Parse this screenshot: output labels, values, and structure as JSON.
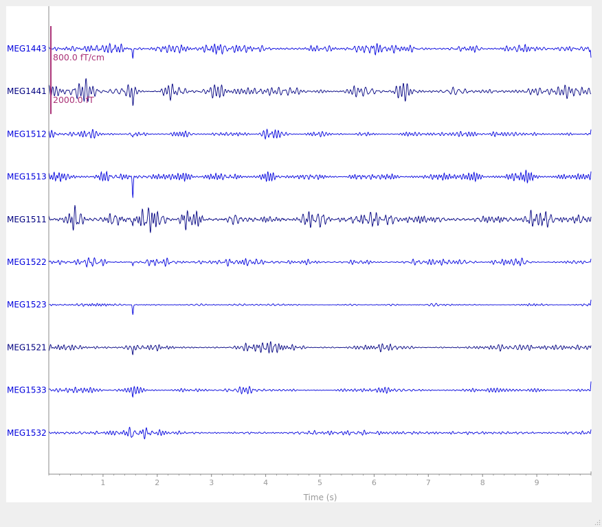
{
  "chart_data": {
    "type": "line",
    "xlabel": "Time (s)",
    "xlim": [
      0,
      10
    ],
    "xticks": [
      1,
      2,
      3,
      4,
      5,
      6,
      7,
      8,
      9
    ],
    "channels": [
      {
        "name": "MEG1443",
        "kind": "grad",
        "color": "#0000dd",
        "amplitude": 0.45,
        "spike": 0.9,
        "end_spike": -1.0
      },
      {
        "name": "MEG1441",
        "kind": "mag",
        "color": "#000080",
        "amplitude": 0.5,
        "spike": 1.2,
        "end_spike": 0.0
      },
      {
        "name": "MEG1512",
        "kind": "grad",
        "color": "#0000dd",
        "amplitude": 0.25,
        "spike": 0.35,
        "end_spike": 0.45
      },
      {
        "name": "MEG1513",
        "kind": "grad",
        "color": "#0000dd",
        "amplitude": 0.35,
        "spike": 1.8,
        "end_spike": 0.35
      },
      {
        "name": "MEG1511",
        "kind": "mag",
        "color": "#000080",
        "amplitude": 0.85,
        "spike": 0.6,
        "end_spike": 0.3
      },
      {
        "name": "MEG1522",
        "kind": "grad",
        "color": "#0000dd",
        "amplitude": 0.35,
        "spike": 0.3,
        "end_spike": 0.3
      },
      {
        "name": "MEG1523",
        "kind": "grad",
        "color": "#0000dd",
        "amplitude": 0.15,
        "spike": 0.9,
        "end_spike": 0.45
      },
      {
        "name": "MEG1521",
        "kind": "mag",
        "color": "#000080",
        "amplitude": 0.3,
        "spike": 0.65,
        "end_spike": 0.2
      },
      {
        "name": "MEG1533",
        "kind": "grad",
        "color": "#0000dd",
        "amplitude": 0.25,
        "spike": 0.35,
        "end_spike": 0.8
      },
      {
        "name": "MEG1532",
        "kind": "grad",
        "color": "#0000dd",
        "amplitude": 0.25,
        "spike": 0.3,
        "end_spike": 0.35
      }
    ],
    "spike_time": 1.55,
    "scale_bars": [
      {
        "label": "800.0 fT/cm",
        "channel_index": 0
      },
      {
        "label": "2000.0 fT",
        "channel_index": 1
      }
    ],
    "scale_bar_color": "#aa3377",
    "axis_color": "#888888"
  }
}
